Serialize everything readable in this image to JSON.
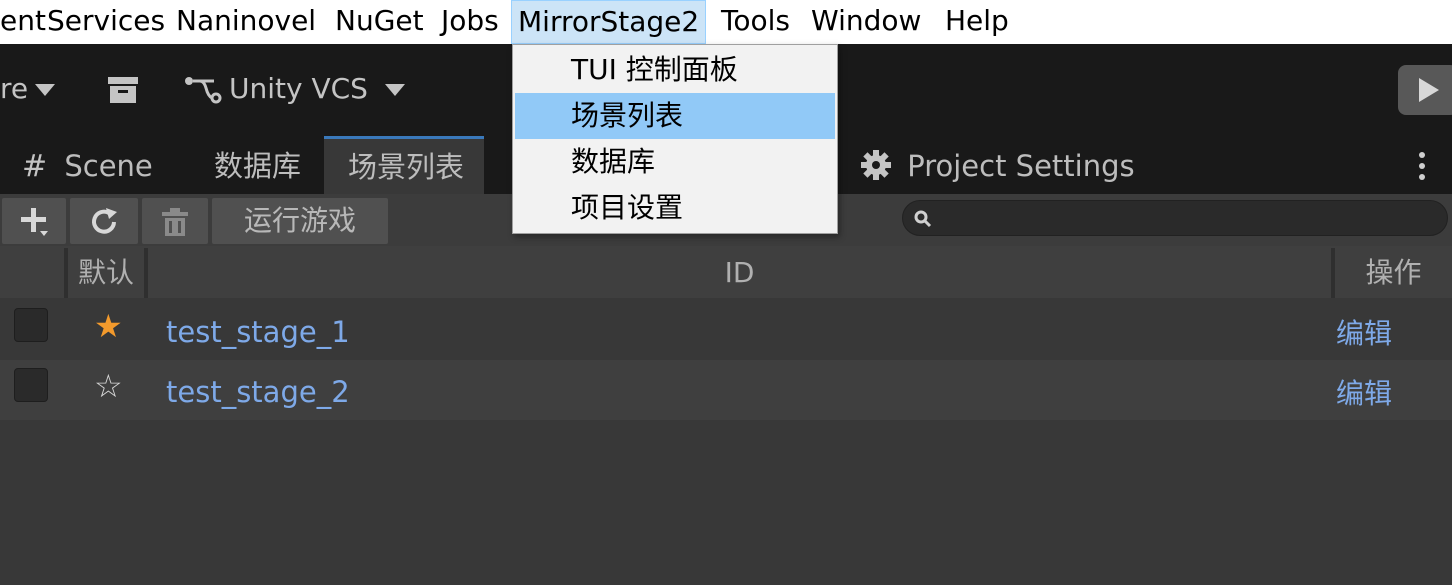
{
  "menubar": {
    "items": [
      "ent",
      "Services",
      "Naninovel",
      "NuGet",
      "Jobs",
      "MirrorStage2",
      "Tools",
      "Window",
      "Help"
    ]
  },
  "toolbar": {
    "left_partial_label": "re",
    "vcs_label": "Unity VCS"
  },
  "tabs": {
    "scene": "Scene",
    "database": "数据库",
    "scene_list": "场景列表",
    "project_settings": "Project Settings"
  },
  "panel_toolbar": {
    "run_game": "运行游戏",
    "search_value": ""
  },
  "table": {
    "headers": {
      "default": "默认",
      "id": "ID",
      "actions": "操作"
    },
    "rows": [
      {
        "default": true,
        "star": "★",
        "id": "test_stage_1",
        "action": "编辑"
      },
      {
        "default": false,
        "star": "☆",
        "id": "test_stage_2",
        "action": "编辑"
      }
    ]
  },
  "dropdown": {
    "items": [
      "TUI 控制面板",
      "场景列表",
      "数据库",
      "项目设置"
    ],
    "highlighted_index": 1
  },
  "colors": {
    "menu_active_bg": "#cce4f7",
    "dropdown_highlight": "#91c9f7",
    "link_blue": "#7ea9e8",
    "star_orange": "#f39a2c",
    "tab_accent": "#3a79bb"
  }
}
